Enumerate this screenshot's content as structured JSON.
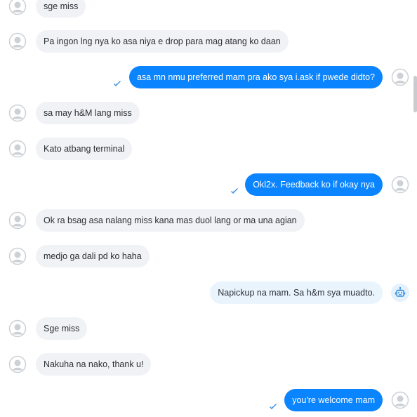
{
  "conversation": {
    "messages": [
      {
        "direction": "incoming",
        "text": "sge miss"
      },
      {
        "direction": "incoming",
        "text": "Pa ingon lng nya ko asa niya e drop para mag atang ko daan"
      },
      {
        "direction": "outgoing",
        "text": "asa mn nmu preferred mam pra ako sya i.ask if pwede didto?",
        "status": "read"
      },
      {
        "direction": "incoming",
        "text": "sa may h&M lang miss"
      },
      {
        "direction": "incoming",
        "text": "Kato atbang terminal"
      },
      {
        "direction": "outgoing",
        "text": "Okl2x. Feedback ko if okay nya",
        "status": "read"
      },
      {
        "direction": "incoming",
        "text": "Ok ra bsag asa nalang miss kana mas duol lang or ma una agian"
      },
      {
        "direction": "incoming",
        "text": "medjo ga dali pd ko haha"
      },
      {
        "direction": "outgoing",
        "sender": "bot",
        "text": "Napickup na mam. Sa h&m sya muadto."
      },
      {
        "direction": "incoming",
        "text": "Sge miss"
      },
      {
        "direction": "incoming",
        "text": "Nakuha na nako, thank u!"
      },
      {
        "direction": "outgoing",
        "text": "you're welcome mam",
        "status": "read"
      }
    ]
  },
  "icons": {
    "user_avatar": "user-avatar-icon",
    "bot_avatar": "robot-icon",
    "read_receipt": "check-icon"
  },
  "colors": {
    "outgoing_bubble": "#0a84ff",
    "incoming_bubble": "#f1f2f5",
    "bot_bubble": "#eaf4fd",
    "check": "#3b8fe0"
  }
}
